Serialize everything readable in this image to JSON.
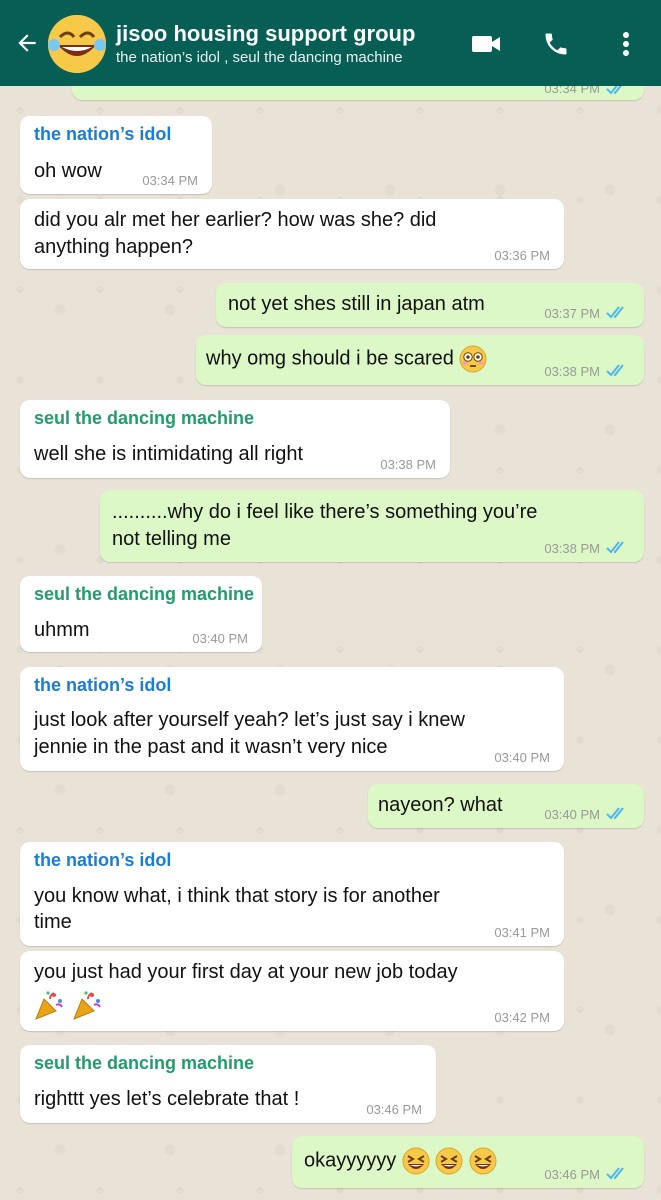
{
  "header": {
    "title": "jisoo housing support group",
    "subtitle": "the nation’s idol , seul the dancing machine",
    "icons": [
      "back-arrow-icon",
      "video-call-icon",
      "phone-icon",
      "more-vert-icon"
    ]
  },
  "colors": {
    "header": "#075e54",
    "incoming": "#ffffff",
    "outgoing": "#dcf8c6",
    "sender_blue": "#1a7dd4",
    "sender_green": "#1f9e6b",
    "read_ticks": "#4fb6ec"
  },
  "messages": [
    {
      "dir": "out",
      "time": "03:34 PM",
      "partial": true
    },
    {
      "dir": "in",
      "sender": "the nation’s idol",
      "lines": [
        "oh wow"
      ],
      "time": "03:34 PM"
    },
    {
      "dir": "in",
      "lines": [
        "did you alr met her earlier? how was she? did",
        "anything happen?"
      ],
      "time": "03:36 PM"
    },
    {
      "dir": "out",
      "lines": [
        "not yet shes still in japan atm"
      ],
      "time": "03:37 PM"
    },
    {
      "dir": "out",
      "lines": [
        "why omg should i be scared"
      ],
      "emoji": "flushed-face",
      "time": "03:38 PM"
    },
    {
      "dir": "in",
      "sender": "seul the dancing machine",
      "lines": [
        "well she is intimidating all right"
      ],
      "time": "03:38 PM"
    },
    {
      "dir": "out",
      "lines": [
        "..........why do i feel like there’s something you’re",
        "not telling me"
      ],
      "time": "03:38 PM"
    },
    {
      "dir": "in",
      "sender": "seul the dancing machine",
      "lines": [
        "uhmm"
      ],
      "time": "03:40 PM"
    },
    {
      "dir": "in",
      "sender": "the nation’s idol",
      "lines": [
        "just look after yourself yeah? let’s just say i knew",
        "jennie in the past and it wasn’t very nice"
      ],
      "time": "03:40 PM"
    },
    {
      "dir": "out",
      "lines": [
        "nayeon? what"
      ],
      "time": "03:40 PM"
    },
    {
      "dir": "in",
      "sender": "the nation’s idol",
      "lines": [
        "you know what, i think that story is for another",
        "time"
      ],
      "time": "03:41 PM"
    },
    {
      "dir": "in",
      "lines": [
        "you just had your first day at your new job today"
      ],
      "emoji": "party-popper x2",
      "time": "03:42 PM"
    },
    {
      "dir": "in",
      "sender": "seul the dancing machine",
      "lines": [
        "righttt yes let’s celebrate that !"
      ],
      "time": "03:46 PM"
    },
    {
      "dir": "out",
      "lines": [
        "okayyyyyy"
      ],
      "emoji": "grinning-squinting-face x3",
      "time": "03:46 PM"
    }
  ]
}
